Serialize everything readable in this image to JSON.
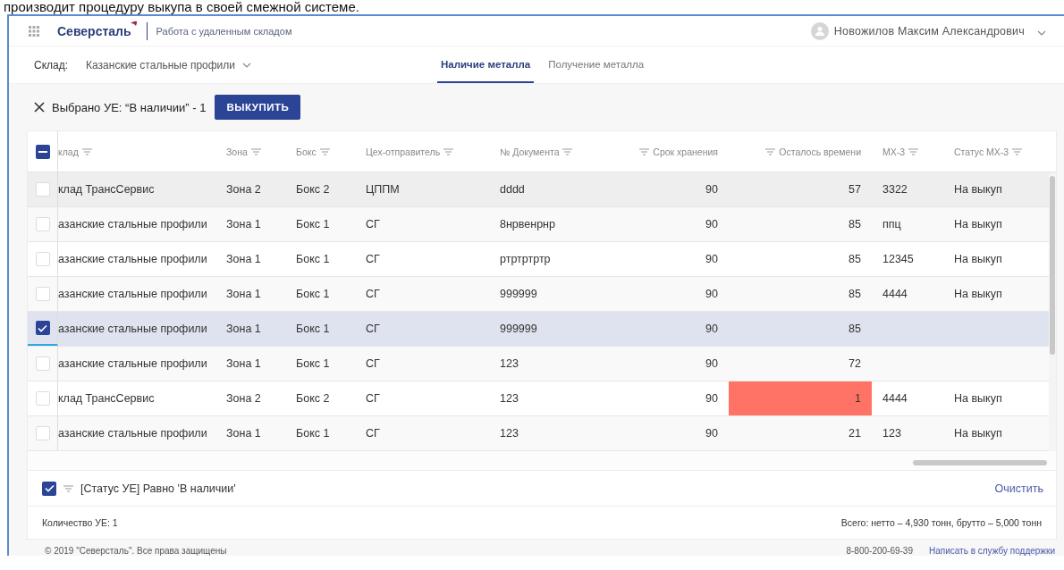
{
  "caption": "производит процедуру выкупа в своей смежной системе.",
  "header": {
    "logo": "Северсталь",
    "subtitle": "Работа с удаленным складом",
    "user": "Новожилов Максим Александрович"
  },
  "warehouse": {
    "label": "Склад:",
    "value": "Казанские стальные профили"
  },
  "tabs": [
    {
      "label": "Наличие металла",
      "selected": true
    },
    {
      "label": "Получение металла",
      "selected": false
    }
  ],
  "selection": {
    "text": "Выбрано УЕ: “В наличии” - 1",
    "button": "ВЫКУПИТЬ"
  },
  "table": {
    "select_all": {
      "indeterminate": true
    },
    "columns": [
      {
        "label": "клад",
        "kind": "text"
      },
      {
        "label": "Зона",
        "kind": "text"
      },
      {
        "label": "Бокс",
        "kind": "text"
      },
      {
        "label": "Цех-отправитель",
        "kind": "text"
      },
      {
        "label": "№ Документа",
        "kind": "text"
      },
      {
        "label": "Срок хранения",
        "kind": "number"
      },
      {
        "label": "Осталось времени",
        "kind": "number"
      },
      {
        "label": "МХ-3",
        "kind": "text"
      },
      {
        "label": "Статус МХ-3",
        "kind": "text"
      }
    ],
    "rows": [
      {
        "checked": false,
        "hovered": true,
        "alert": false,
        "cells": [
          "клад ТрансСервис",
          "Зона 2",
          "Бокс 2",
          "ЦППМ",
          "dddd",
          "90",
          "57",
          "3322",
          "На выкуп"
        ]
      },
      {
        "checked": false,
        "alert": false,
        "cells": [
          "азанские стальные профили",
          "Зона 1",
          "Бокс 1",
          "СГ",
          "8нрвенрнр",
          "90",
          "85",
          "ппц",
          "На выкуп"
        ]
      },
      {
        "checked": false,
        "alert": false,
        "cells": [
          "азанские стальные профили",
          "Зона 1",
          "Бокс 1",
          "СГ",
          "ртртртртр",
          "90",
          "85",
          "12345",
          "На выкуп"
        ]
      },
      {
        "checked": false,
        "alert": false,
        "cells": [
          "азанские стальные профили",
          "Зона 1",
          "Бокс 1",
          "СГ",
          "999999",
          "90",
          "85",
          "4444",
          "На выкуп"
        ]
      },
      {
        "checked": true,
        "alert": false,
        "cells": [
          "азанские стальные профили",
          "Зона 1",
          "Бокс 1",
          "СГ",
          "999999",
          "90",
          "85"
        ]
      },
      {
        "checked": false,
        "alert": false,
        "cells": [
          "азанские стальные профили",
          "Зона 1",
          "Бокс 1",
          "СГ",
          "123",
          "90",
          "72"
        ]
      },
      {
        "checked": false,
        "alert": true,
        "cells": [
          "клад ТрансСервис",
          "Зона 2",
          "Бокс 2",
          "СГ",
          "123",
          "90",
          "1",
          "4444",
          "На выкуп"
        ]
      },
      {
        "checked": false,
        "alert": false,
        "cells": [
          "азанские стальные профили",
          "Зона 1",
          "Бокс 1",
          "СГ",
          "123",
          "90",
          "21",
          "123",
          "На выкуп"
        ]
      }
    ]
  },
  "filter": {
    "checked": true,
    "text": "[Статус УЕ] Равно 'В наличии'",
    "clear": "Очистить"
  },
  "summary": {
    "count": "Количество УЕ: 1",
    "total": "Всего: нетто – 4,930 тонн, брутто – 5,000 тонн"
  },
  "footer": {
    "copyright": "© 2019 \"Северсталь\". Все права защищены",
    "phone": "8-800-200-69-39",
    "support": "Написать в службу поддержки"
  }
}
